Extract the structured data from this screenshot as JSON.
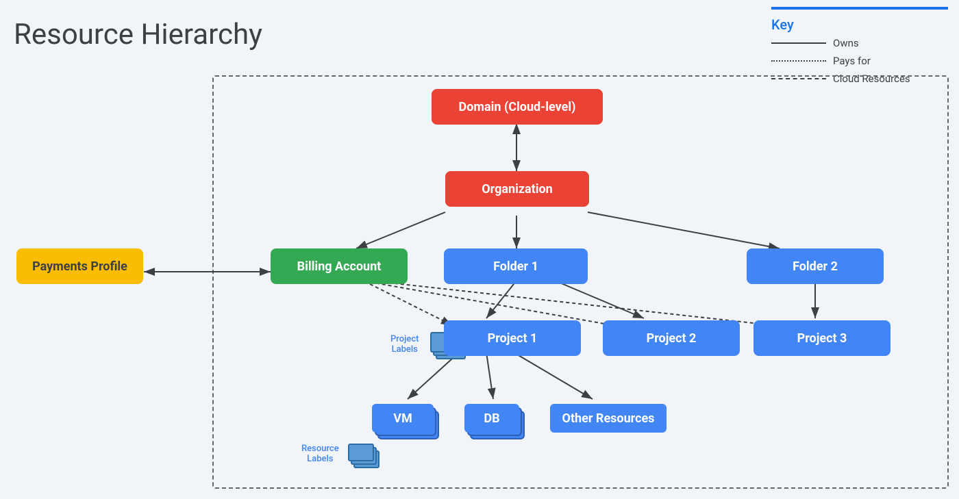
{
  "title": "Resource Hierarchy",
  "key": {
    "title": "Key",
    "items": [
      {
        "line": "solid",
        "label": "Owns"
      },
      {
        "line": "dotted",
        "label": "Pays for"
      },
      {
        "line": "dashed",
        "label": "Cloud Resources"
      }
    ]
  },
  "nodes": {
    "domain": {
      "label": "Domain (Cloud-level)",
      "color": "red"
    },
    "organization": {
      "label": "Organization",
      "color": "red"
    },
    "billingAccount": {
      "label": "Billing Account",
      "color": "green"
    },
    "paymentsProfile": {
      "label": "Payments Profile",
      "color": "yellow"
    },
    "folder1": {
      "label": "Folder 1",
      "color": "blue"
    },
    "folder2": {
      "label": "Folder 2",
      "color": "blue"
    },
    "project1": {
      "label": "Project 1",
      "color": "blue"
    },
    "project2": {
      "label": "Project 2",
      "color": "blue"
    },
    "project3": {
      "label": "Project 3",
      "color": "blue"
    },
    "vm": {
      "label": "VM",
      "color": "blue"
    },
    "db": {
      "label": "DB",
      "color": "blue"
    },
    "otherResources": {
      "label": "Other Resources",
      "color": "blue"
    }
  },
  "labels": {
    "projectLabels": "Project\nLabels",
    "resourceLabels": "Resource\nLabels"
  }
}
